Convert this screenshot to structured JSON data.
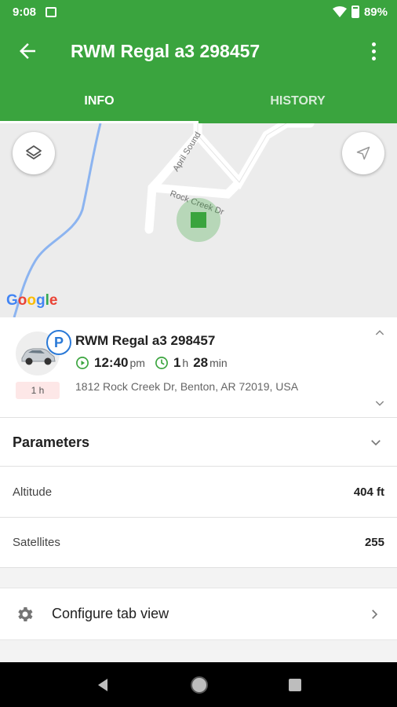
{
  "status_bar": {
    "time": "9:08",
    "battery": "89%"
  },
  "app_bar": {
    "title": "RWM Regal a3 298457"
  },
  "tabs": [
    {
      "label": "INFO",
      "active": true
    },
    {
      "label": "HISTORY",
      "active": false
    }
  ],
  "map": {
    "streets": [
      "April Sound",
      "Rock Creek Dr"
    ],
    "attribution": "Google"
  },
  "vehicle": {
    "name": "RWM Regal a3 298457",
    "status_badge": "P",
    "duration_badge": "1 h",
    "time_value": "12:40",
    "time_unit": "pm",
    "duration_hours": "1",
    "duration_hours_unit": "h",
    "duration_minutes": "28",
    "duration_minutes_unit": "min",
    "address": "1812 Rock Creek Dr, Benton, AR 72019, USA"
  },
  "parameters": {
    "header": "Parameters",
    "rows": [
      {
        "label": "Altitude",
        "value": "404 ft"
      },
      {
        "label": "Satellites",
        "value": "255"
      }
    ]
  },
  "configure": {
    "label": "Configure tab view"
  },
  "colors": {
    "primary": "#3aa43e",
    "accent_blue": "#2a79d7",
    "marker": "#3aa43e",
    "badge_bg": "#fde7e7"
  },
  "icons": {
    "back": "arrow-left-icon",
    "more": "more-vert-icon",
    "layers": "layers-icon",
    "locate": "navigation-icon",
    "play": "play-circle-icon",
    "clock": "clock-icon",
    "settings": "gear-icon"
  }
}
